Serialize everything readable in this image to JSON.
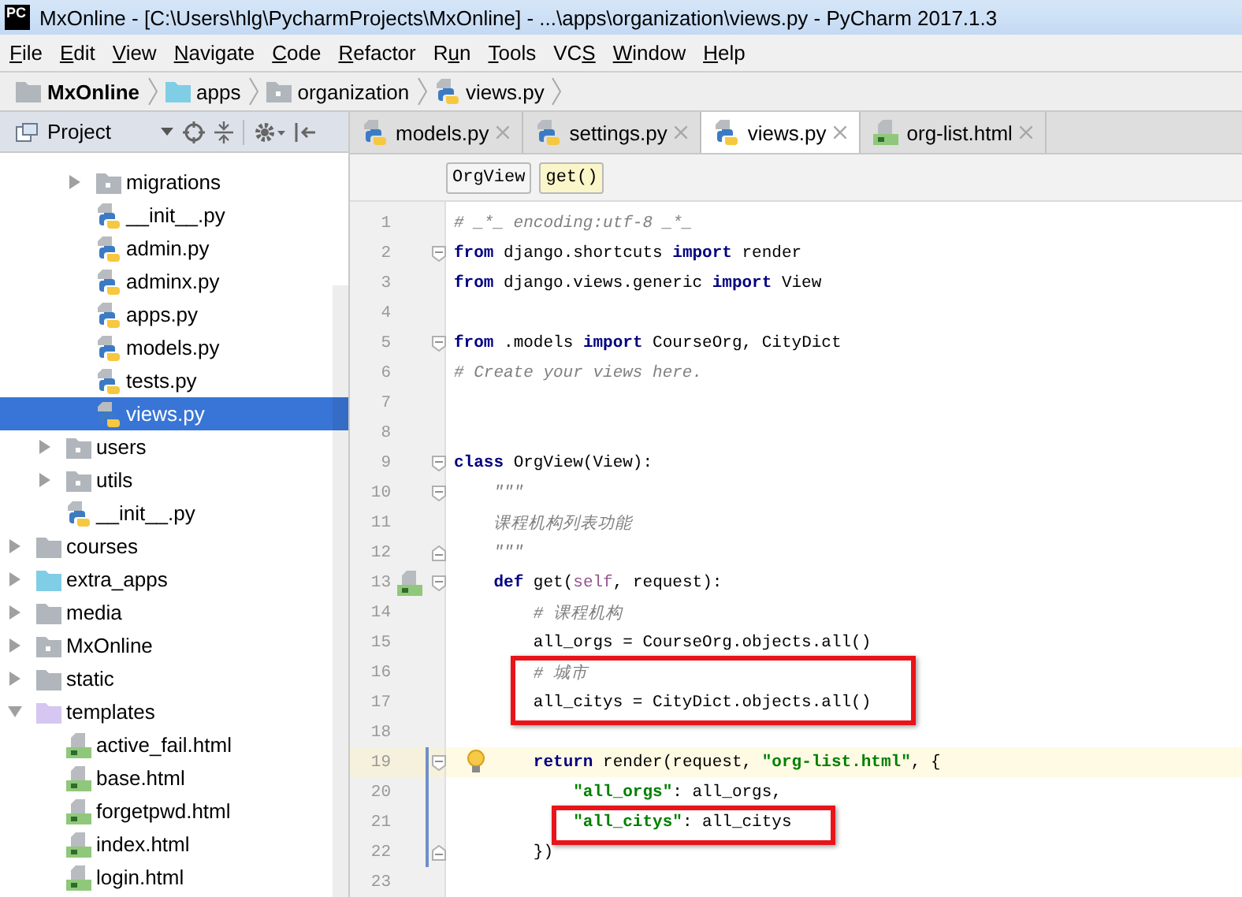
{
  "window": {
    "logo": "PC",
    "title": "MxOnline - [C:\\Users\\hlg\\PycharmProjects\\MxOnline] - ...\\apps\\organization\\views.py - PyCharm 2017.1.3"
  },
  "menu": [
    {
      "parts": [
        {
          "text": "F",
          "underlined": true
        },
        {
          "text": "ile",
          "underlined": false
        }
      ]
    },
    {
      "parts": [
        {
          "text": "E",
          "underlined": true
        },
        {
          "text": "dit",
          "underlined": false
        }
      ]
    },
    {
      "parts": [
        {
          "text": "V",
          "underlined": true
        },
        {
          "text": "iew",
          "underlined": false
        }
      ]
    },
    {
      "parts": [
        {
          "text": "N",
          "underlined": true
        },
        {
          "text": "avigate",
          "underlined": false
        }
      ]
    },
    {
      "parts": [
        {
          "text": "C",
          "underlined": true
        },
        {
          "text": "ode",
          "underlined": false
        }
      ]
    },
    {
      "parts": [
        {
          "text": "R",
          "underlined": true
        },
        {
          "text": "efactor",
          "underlined": false
        }
      ]
    },
    {
      "parts": [
        {
          "text": "R",
          "underlined": false
        },
        {
          "text": "u",
          "underlined": true
        },
        {
          "text": "n",
          "underlined": false
        }
      ]
    },
    {
      "parts": [
        {
          "text": "T",
          "underlined": true
        },
        {
          "text": "ools",
          "underlined": false
        }
      ]
    },
    {
      "parts": [
        {
          "text": "VC",
          "underlined": false
        },
        {
          "text": "S",
          "underlined": true
        }
      ]
    },
    {
      "parts": [
        {
          "text": "W",
          "underlined": true
        },
        {
          "text": "indow",
          "underlined": false
        }
      ]
    },
    {
      "parts": [
        {
          "text": "H",
          "underlined": true
        },
        {
          "text": "elp",
          "underlined": false
        }
      ]
    }
  ],
  "breadcrumbs": [
    {
      "label": "MxOnline",
      "kind": "folder"
    },
    {
      "label": "apps",
      "kind": "source"
    },
    {
      "label": "organization",
      "kind": "package"
    },
    {
      "label": "views.py",
      "kind": "python"
    }
  ],
  "project_panel": {
    "view": "Project",
    "tree": [
      {
        "children": [
          {
            "children": [
              {
                "label": "migrations",
                "kind": "package",
                "expanded": false,
                "selected": false
              },
              {
                "label": "__init__.py",
                "kind": "python",
                "selected": false
              },
              {
                "label": "admin.py",
                "kind": "python",
                "selected": false
              },
              {
                "label": "adminx.py",
                "kind": "python",
                "selected": false
              },
              {
                "label": "apps.py",
                "kind": "python",
                "selected": false
              },
              {
                "label": "models.py",
                "kind": "python",
                "selected": false
              },
              {
                "label": "tests.py",
                "kind": "python",
                "selected": false
              },
              {
                "label": "views.py",
                "kind": "python",
                "selected": true
              }
            ]
          },
          {
            "label": "users",
            "kind": "package",
            "expanded": false,
            "selected": false
          },
          {
            "label": "utils",
            "kind": "package",
            "expanded": false,
            "selected": false
          },
          {
            "label": "__init__.py",
            "kind": "python",
            "selected": false
          }
        ]
      },
      {
        "label": "courses",
        "kind": "folder",
        "expanded": false,
        "selected": false
      },
      {
        "label": "extra_apps",
        "kind": "source",
        "expanded": false,
        "selected": false
      },
      {
        "label": "media",
        "kind": "folder",
        "expanded": false,
        "selected": false
      },
      {
        "label": "MxOnline",
        "kind": "package",
        "expanded": false,
        "selected": false
      },
      {
        "label": "static",
        "kind": "folder",
        "expanded": false,
        "selected": false
      },
      {
        "label": "templates",
        "kind": "templates",
        "expanded": true,
        "selected": false,
        "children": [
          {
            "label": "active_fail.html",
            "kind": "html",
            "selected": false
          },
          {
            "label": "base.html",
            "kind": "html",
            "selected": false
          },
          {
            "label": "forgetpwd.html",
            "kind": "html",
            "selected": false
          },
          {
            "label": "index.html",
            "kind": "html",
            "selected": false
          },
          {
            "label": "login.html",
            "kind": "html",
            "selected": false
          }
        ]
      }
    ]
  },
  "editor": {
    "tabs": [
      {
        "label": "models.py",
        "kind": "python",
        "selected": false
      },
      {
        "label": "settings.py",
        "kind": "python",
        "selected": false
      },
      {
        "label": "views.py",
        "kind": "python",
        "selected": true
      },
      {
        "label": "org-list.html",
        "kind": "html",
        "selected": false
      }
    ],
    "crumbs": [
      {
        "label": "OrgView",
        "selected": false
      },
      {
        "label": "get()",
        "selected": true
      }
    ],
    "lines": [
      {
        "number": "1",
        "current": false,
        "changed": false,
        "boxed": false,
        "tokens": [
          {
            "kind": "comment",
            "text": "# _*_ encoding:utf-8 _*_"
          }
        ]
      },
      {
        "number": "2",
        "current": false,
        "changed": false,
        "boxed": false,
        "fold": {
          "kind": "start"
        },
        "tokens": [
          {
            "kind": "keyword",
            "text": "from"
          },
          {
            "kind": "plain",
            "text": " django.shortcuts "
          },
          {
            "kind": "keyword",
            "text": "import"
          },
          {
            "kind": "plain",
            "text": " render"
          }
        ]
      },
      {
        "number": "3",
        "current": false,
        "changed": false,
        "boxed": false,
        "tokens": [
          {
            "kind": "keyword",
            "text": "from"
          },
          {
            "kind": "plain",
            "text": " django.views.generic "
          },
          {
            "kind": "keyword",
            "text": "import"
          },
          {
            "kind": "plain",
            "text": " View"
          }
        ]
      },
      {
        "number": "4",
        "current": false,
        "changed": false,
        "boxed": false
      },
      {
        "number": "5",
        "current": false,
        "changed": false,
        "boxed": false,
        "fold": {
          "kind": "start"
        },
        "tokens": [
          {
            "kind": "keyword",
            "text": "from"
          },
          {
            "kind": "plain",
            "text": " .models "
          },
          {
            "kind": "keyword",
            "text": "import"
          },
          {
            "kind": "plain",
            "text": " CourseOrg, CityDict"
          }
        ]
      },
      {
        "number": "6",
        "current": false,
        "changed": false,
        "boxed": false,
        "tokens": [
          {
            "kind": "comment",
            "text": "# Create your views here."
          }
        ]
      },
      {
        "number": "7",
        "current": false,
        "changed": false,
        "boxed": false
      },
      {
        "number": "8",
        "current": false,
        "changed": false,
        "boxed": false
      },
      {
        "number": "9",
        "current": false,
        "changed": false,
        "boxed": false,
        "fold": {
          "kind": "start"
        },
        "tokens": [
          {
            "kind": "keyword",
            "text": "class"
          },
          {
            "kind": "plain",
            "text": " OrgView(View):"
          }
        ]
      },
      {
        "number": "10",
        "current": false,
        "changed": false,
        "boxed": false,
        "fold": {
          "kind": "start"
        },
        "tokens": [
          {
            "kind": "comment",
            "text": "    \"\"\""
          }
        ]
      },
      {
        "number": "11",
        "current": false,
        "changed": false,
        "boxed": false,
        "tokens": [
          {
            "kind": "comment",
            "text": "    课程机构列表功能"
          }
        ]
      },
      {
        "number": "12",
        "current": false,
        "changed": false,
        "boxed": false,
        "fold": {
          "kind": "end"
        },
        "tokens": [
          {
            "kind": "comment",
            "text": "    \"\"\""
          }
        ]
      },
      {
        "number": "13",
        "current": false,
        "changed": false,
        "boxed": false,
        "fold": {
          "kind": "start"
        },
        "gutter_icon": {
          "kind": "html"
        },
        "tokens": [
          {
            "kind": "keyword",
            "text": "    def"
          },
          {
            "kind": "plain",
            "text": " get("
          },
          {
            "kind": "self",
            "text": "self"
          },
          {
            "kind": "plain",
            "text": ", request):"
          }
        ]
      },
      {
        "number": "14",
        "current": false,
        "changed": false,
        "boxed": false,
        "tokens": [
          {
            "kind": "comment",
            "text": "        # 课程机构"
          }
        ]
      },
      {
        "number": "15",
        "current": false,
        "changed": false,
        "boxed": false,
        "tokens": [
          {
            "kind": "plain",
            "text": "        all_orgs = CourseOrg.objects.all()"
          }
        ]
      },
      {
        "number": "16",
        "current": false,
        "changed": false,
        "boxed": true,
        "tokens": [
          {
            "kind": "comment",
            "text": "        # 城市"
          }
        ]
      },
      {
        "number": "17",
        "current": false,
        "changed": false,
        "boxed": true,
        "tokens": [
          {
            "kind": "plain",
            "text": "        all_citys = CityDict.objects.all()"
          }
        ]
      },
      {
        "number": "18",
        "current": false,
        "changed": false,
        "boxed": false
      },
      {
        "number": "19",
        "current": true,
        "changed": true,
        "boxed": false,
        "fold": {
          "kind": "start"
        },
        "gutter_icon": {
          "kind": "bulb"
        },
        "tokens": [
          {
            "kind": "keyword",
            "text": "        return"
          },
          {
            "kind": "plain",
            "text": " render(request, "
          },
          {
            "kind": "string",
            "text": "\"org-list.html\""
          },
          {
            "kind": "plain",
            "text": ", {"
          }
        ]
      },
      {
        "number": "20",
        "current": false,
        "changed": true,
        "boxed": false,
        "tokens": [
          {
            "kind": "string",
            "text": "            \"all_orgs\""
          },
          {
            "kind": "plain",
            "text": ": all_orgs,"
          }
        ]
      },
      {
        "number": "21",
        "current": false,
        "changed": true,
        "boxed": true,
        "tokens": [
          {
            "kind": "string",
            "text": "            \"all_citys\""
          },
          {
            "kind": "plain",
            "text": ": all_citys"
          }
        ]
      },
      {
        "number": "22",
        "current": false,
        "changed": true,
        "boxed": false,
        "fold": {
          "kind": "end"
        },
        "tokens": [
          {
            "kind": "plain",
            "text": "        })"
          }
        ]
      },
      {
        "number": "23",
        "current": false,
        "changed": false,
        "boxed": false
      }
    ]
  }
}
